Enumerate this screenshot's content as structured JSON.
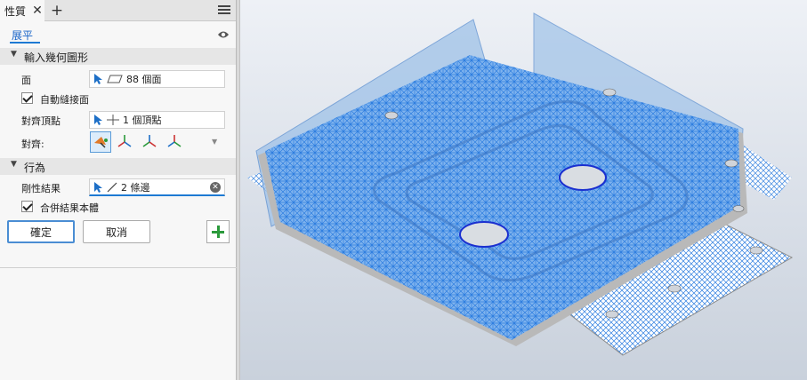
{
  "panel": {
    "tab_label": "性質",
    "title": "展平",
    "input_section": "輸入幾何圖形",
    "face_label": "面",
    "face_value": "88 個面",
    "auto_stitch_label": "自動縫接面",
    "align_vertex_label": "對齊頂點",
    "align_vertex_value": "1 個頂點",
    "align_label": "對齊:",
    "behavior_section": "行為",
    "rigid_label": "剛性結果",
    "rigid_value": "2 條邊",
    "merge_label": "合併結果本體",
    "ok_label": "確定",
    "cancel_label": "取消"
  },
  "icons": [
    "close-icon",
    "add-icon",
    "menu-icon",
    "eye-icon",
    "cursor-icon",
    "face-icon",
    "vertex-icon",
    "edge-icon",
    "clear-icon",
    "align-vertex-icon",
    "align-x-icon",
    "align-y-icon",
    "align-z-icon"
  ],
  "colors": {
    "accent": "#1d7ad3",
    "mesh": "#2e7ee0",
    "mesh_fill": "#7fb3ee",
    "hole": "#1a2fd0",
    "add_green": "#2b9a3b"
  }
}
